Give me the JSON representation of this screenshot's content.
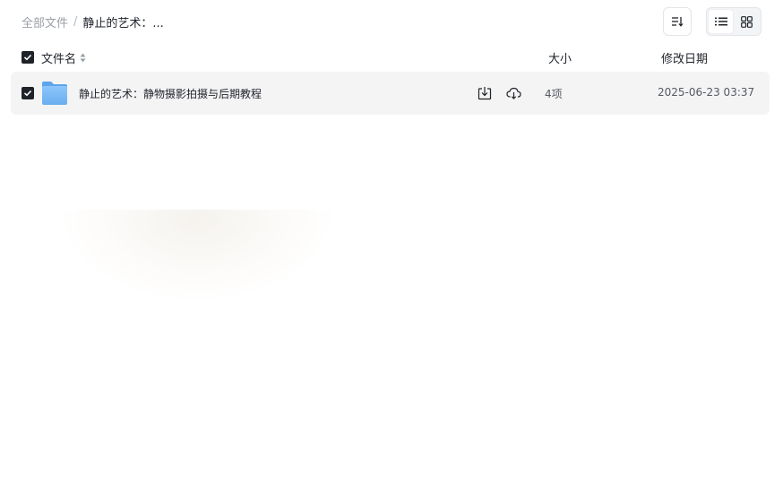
{
  "breadcrumb": {
    "root": "全部文件",
    "separator": "/",
    "current": "静止的艺术：..."
  },
  "toolbar": {
    "sort_icon": "sort-list-icon",
    "view_list_icon": "list-view-icon",
    "view_grid_icon": "grid-view-icon",
    "active_view": "list"
  },
  "table": {
    "header": {
      "name": "文件名",
      "size": "大小",
      "modified": "修改日期",
      "select_all_checked": true
    },
    "rows": [
      {
        "checked": true,
        "type_icon": "folder-icon",
        "name": "静止的艺术：静物摄影拍摄与后期教程",
        "size": "4项",
        "modified": "2025-06-23 03:37",
        "actions": [
          "download-icon",
          "cloud-save-icon"
        ]
      }
    ]
  },
  "colors": {
    "folder": "#7ab8f5",
    "row_bg": "#f4f4f5",
    "checkbox": "#1f2329"
  }
}
